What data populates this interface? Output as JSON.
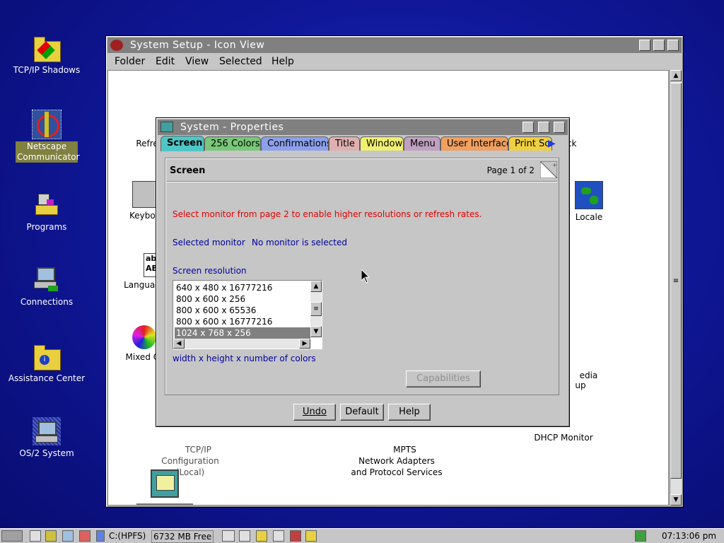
{
  "desktop": {
    "icons": [
      {
        "label": "TCP/IP Shadows"
      },
      {
        "label": "Netscape Communicator"
      },
      {
        "label": "Programs"
      },
      {
        "label": "Connections"
      },
      {
        "label": "Assistance Center"
      },
      {
        "label": "OS/2 System"
      }
    ]
  },
  "window": {
    "title": "System Setup - Icon View",
    "menu": [
      "Folder",
      "Edit",
      "View",
      "Selected",
      "Help"
    ],
    "icons": [
      {
        "label": "Refresh"
      },
      {
        "label": "Keyboa"
      },
      {
        "label": "Languag"
      },
      {
        "label": "Mixed Co"
      },
      {
        "label": "ock"
      },
      {
        "label": "Locale"
      },
      {
        "label": "edia\nup"
      },
      {
        "label": "TCP/IP\nConfiguration\n(Local)"
      },
      {
        "label": "MPTS\nNetwork Adapters\nand Protocol Services"
      },
      {
        "label": "DHCP Monitor"
      }
    ]
  },
  "dialog": {
    "title": "System - Properties",
    "tabs": [
      "Screen",
      "256 Colors",
      "Confirmations",
      "Title",
      "Window",
      "Menu",
      "User Interface",
      "Print Scr"
    ],
    "page_title": "Screen",
    "page_number": "Page 1 of 2",
    "warning": "Select monitor from page 2 to enable higher resolutions or refresh rates.",
    "selected_monitor_label": "Selected monitor",
    "selected_monitor_value": "No monitor is selected",
    "resolution_label": "Screen resolution",
    "resolutions": [
      "640 x 480 x 16777216",
      "800 x 600 x 256",
      "800 x 600 x 65536",
      "800 x 600 x 16777216",
      "1024 x 768 x 256"
    ],
    "selected_resolution": "1024 x 768 x 256",
    "resolution_hint": "width x height x number of colors",
    "capabilities_label": "Capabilities",
    "buttons": {
      "undo": "Undo",
      "default": "Default",
      "help": "Help"
    }
  },
  "taskbar": {
    "drive": "C:(HPFS)",
    "free": "6732 MB Free",
    "time": "07:13:06 pm"
  },
  "colors": {
    "desktop": "#1020a0",
    "active_tab": "#4fc6c6",
    "warning_text": "#e00000",
    "info_text": "#0000a0"
  }
}
